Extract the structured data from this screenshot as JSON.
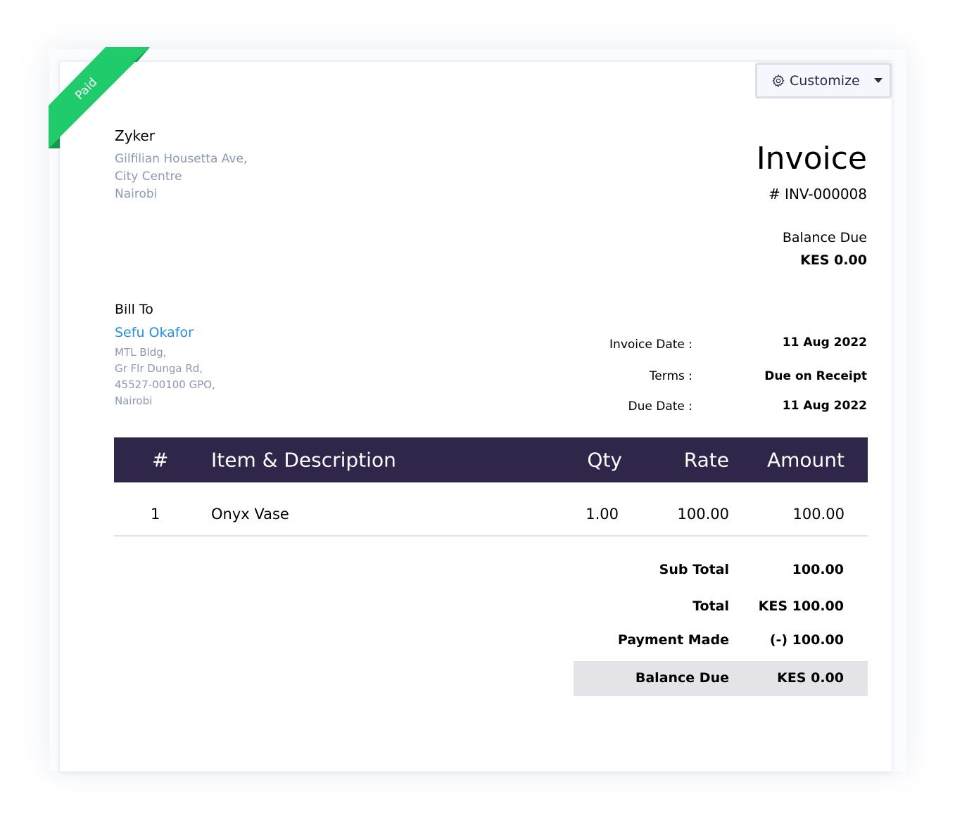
{
  "ribbon": {
    "label": "Paid",
    "color": "#1fcb6b"
  },
  "toolbar": {
    "customize_label": "Customize",
    "icon": "gear-icon"
  },
  "org": {
    "name": "Zyker",
    "address": [
      "Gilfilian Housetta Ave,",
      "City Centre",
      "Nairobi"
    ]
  },
  "invoice": {
    "title": "Invoice",
    "number": "# INV-000008",
    "balance_due_label": "Balance Due",
    "balance_due": "KES 0.00"
  },
  "bill_to": {
    "label": "Bill To",
    "name": "Sefu Okafor",
    "address": [
      "MTL Bldg,",
      "Gr Flr Dunga Rd,",
      "45527-00100 GPO,",
      "Nairobi"
    ]
  },
  "meta": [
    {
      "label": "Invoice Date :",
      "value": "11 Aug 2022"
    },
    {
      "label": "Terms :",
      "value": "Due on Receipt"
    },
    {
      "label": "Due Date :",
      "value": "11 Aug 2022"
    }
  ],
  "table": {
    "headers": {
      "num": "#",
      "item": "Item & Description",
      "qty": "Qty",
      "rate": "Rate",
      "amount": "Amount"
    },
    "rows": [
      {
        "num": "1",
        "item": "Onyx Vase",
        "qty": "1.00",
        "rate": "100.00",
        "amount": "100.00"
      }
    ]
  },
  "totals": {
    "sub_total_label": "Sub Total",
    "sub_total": "100.00",
    "total_label": "Total",
    "total": "KES 100.00",
    "payment_label": "Payment Made",
    "payment": "(-) 100.00",
    "balance_label": "Balance Due",
    "balance": "KES 0.00"
  }
}
